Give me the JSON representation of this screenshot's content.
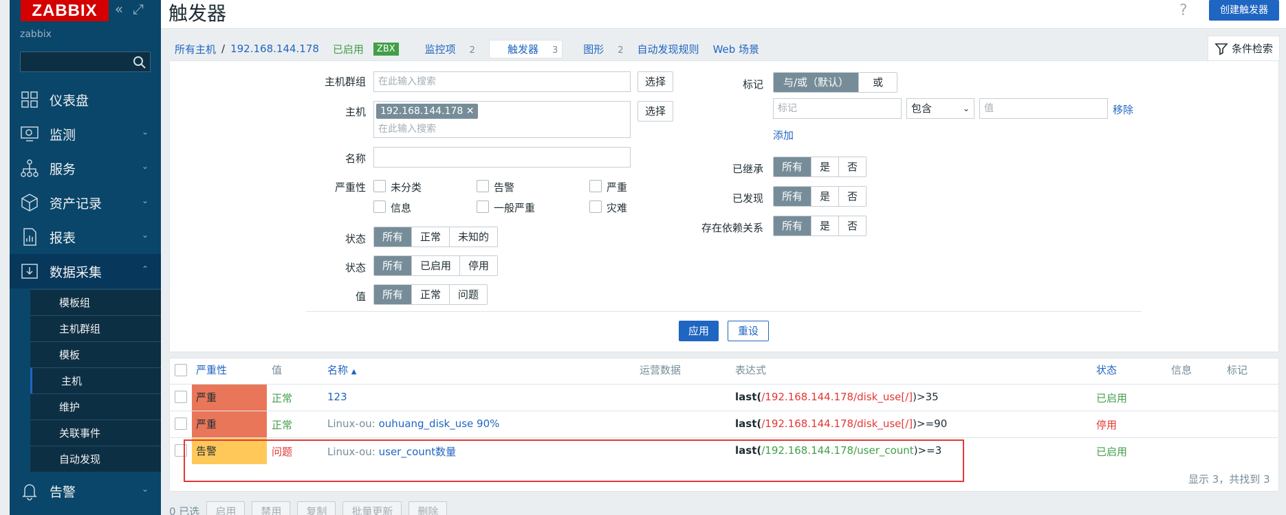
{
  "sidebar": {
    "logo": "ZABBIX",
    "instance": "zabbix",
    "menu": [
      {
        "label": "仪表盘",
        "icon": "dashboard-icon"
      },
      {
        "label": "监测",
        "icon": "monitoring-icon"
      },
      {
        "label": "服务",
        "icon": "services-icon"
      },
      {
        "label": "资产记录",
        "icon": "inventory-icon"
      },
      {
        "label": "报表",
        "icon": "reports-icon"
      },
      {
        "label": "数据采集",
        "icon": "data-collection-icon"
      },
      {
        "label": "告警",
        "icon": "alerts-icon"
      }
    ],
    "submenu": [
      "模板组",
      "主机群组",
      "模板",
      "主机",
      "维护",
      "关联事件",
      "自动发现"
    ]
  },
  "header": {
    "title": "触发器",
    "help": "?",
    "create_button": "创建触发器"
  },
  "breadcrumb": {
    "all_hosts": "所有主机",
    "sep": "/",
    "host": "192.168.144.178",
    "enabled": "已启用",
    "zbx": "ZBX",
    "items": "监控项",
    "items_count": "2",
    "triggers": "触发器",
    "triggers_count": "3",
    "graphs": "图形",
    "graphs_count": "2",
    "discovery": "自动发现规则",
    "web": "Web 场景"
  },
  "filter": {
    "tab_label": "条件检索",
    "host_group_label": "主机群组",
    "search_placeholder": "在此输入搜索",
    "select": "选择",
    "host_label": "主机",
    "host_chip": "192.168.144.178",
    "chip_close": "✕",
    "name_label": "名称",
    "severity_label": "严重性",
    "severities": [
      "未分类",
      "告警",
      "严重",
      "信息",
      "一般严重",
      "灾难"
    ],
    "state_label": "状态",
    "state_options": [
      "所有",
      "正常",
      "未知的"
    ],
    "status_label": "状态",
    "status_options": [
      "所有",
      "已启用",
      "停用"
    ],
    "value_label": "值",
    "value_options": [
      "所有",
      "正常",
      "问题"
    ],
    "tags_label": "标记",
    "tag_mode": [
      "与/或（默认）",
      "或"
    ],
    "tag_placeholder": "标记",
    "tag_op": "包含",
    "value_placeholder": "值",
    "remove": "移除",
    "add": "添加",
    "inherited_label": "已继承",
    "discovered_label": "已发现",
    "dependencies_label": "存在依赖关系",
    "yn_options": [
      "所有",
      "是",
      "否"
    ],
    "apply": "应用",
    "reset": "重设"
  },
  "table": {
    "headers": {
      "severity": "严重性",
      "value": "值",
      "name": "名称",
      "sort": "▲",
      "operational": "运营数据",
      "expression": "表达式",
      "status": "状态",
      "info": "信息",
      "tags": "标记"
    },
    "rows": [
      {
        "severity": "严重",
        "sev_color": "#e97659",
        "value": "正常",
        "name_prefix": "",
        "name": "123",
        "expr_fn": "last(",
        "expr_item": "/192.168.144.178/disk_use[/]",
        "expr_tail": ")>35",
        "status": "已启用",
        "item_color": "#e33734"
      },
      {
        "severity": "严重",
        "sev_color": "#e97659",
        "value": "正常",
        "name_prefix": "Linux-ou: ",
        "name": "ouhuang_disk_use 90%",
        "expr_fn": "last(",
        "expr_item": "/192.168.144.178/disk_use[/]",
        "expr_tail": ")>=90",
        "status": "停用",
        "item_color": "#e33734"
      },
      {
        "severity": "告警",
        "sev_color": "#ffc859",
        "value": "问题",
        "name_prefix": "Linux-ou: ",
        "name": "user_count数量",
        "expr_fn": "last(",
        "expr_item": "/192.168.144.178/user_count",
        "expr_tail": ")>=3",
        "status": "已启用",
        "item_color": "#429e47"
      }
    ],
    "footer": "显示 3，共找到 3"
  },
  "bottom": {
    "selected": "0 已选",
    "buttons": [
      "启用",
      "禁用",
      "复制",
      "批量更新",
      "删除"
    ]
  }
}
